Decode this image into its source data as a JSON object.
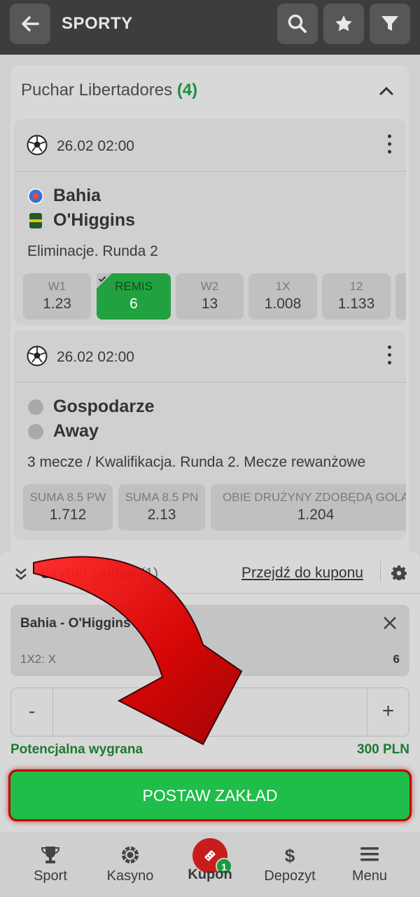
{
  "header": {
    "title": "SPORTY",
    "icons": [
      "back-arrow-icon",
      "search-icon",
      "star-icon",
      "filter-icon"
    ]
  },
  "league": {
    "name": "Puchar Libertadores",
    "count": "(4)"
  },
  "matches": [
    {
      "date": "26.02 02:00",
      "home": "Bahia",
      "away": "O'Higgins",
      "round": "Eliminacje. Runda 2",
      "odds": [
        {
          "label": "W1",
          "value": "1.23",
          "selected": false
        },
        {
          "label": "REMIS",
          "value": "6",
          "selected": true
        },
        {
          "label": "W2",
          "value": "13",
          "selected": false
        },
        {
          "label": "1X",
          "value": "1.008",
          "selected": false
        },
        {
          "label": "12",
          "value": "1.133",
          "selected": false
        }
      ]
    },
    {
      "date": "26.02 02:00",
      "home": "Gospodarze",
      "away": "Away",
      "round": "3 mecze / Kwalifikacja. Runda 2. Mecze rewanżowe",
      "odds": [
        {
          "label": "SUMA 8.5 PW",
          "value": "1.712",
          "selected": false
        },
        {
          "label": "SUMA 8.5 PN",
          "value": "2.13",
          "selected": false
        },
        {
          "label": "OBIE DRUŻYNY ZDOBĘDĄ GOLA",
          "value": "1.204",
          "selected": false
        }
      ]
    }
  ],
  "betslip": {
    "title": "Szybki zakład",
    "count": "(1)",
    "goto_label": "Przejdź do kuponu",
    "bet": {
      "teams": "Bahia - O'Higgins",
      "market": "1X2: X",
      "odd": "6"
    },
    "stake_minus": "-",
    "stake_plus": "+",
    "stake_value": "",
    "potential_label": "Potencjalna wygrana",
    "potential_value": "300 PLN",
    "place_bet_label": "POSTAW ZAKŁAD"
  },
  "nav": {
    "items": [
      {
        "label": "Sport",
        "icon": "trophy-icon"
      },
      {
        "label": "Kasyno",
        "icon": "casino-chip-icon"
      },
      {
        "label": "Kupon",
        "icon": "ticket-icon",
        "badge": "1",
        "active": true
      },
      {
        "label": "Depozyt",
        "icon": "dollar-icon"
      },
      {
        "label": "Menu",
        "icon": "hamburger-icon"
      }
    ]
  },
  "colors": {
    "header_bg": "#3d3d3d",
    "accent_green": "#1fbd4a",
    "selected_odd": "#21a13f",
    "arrow_red": "#d10000",
    "kupon_red": "#c81d1d"
  }
}
